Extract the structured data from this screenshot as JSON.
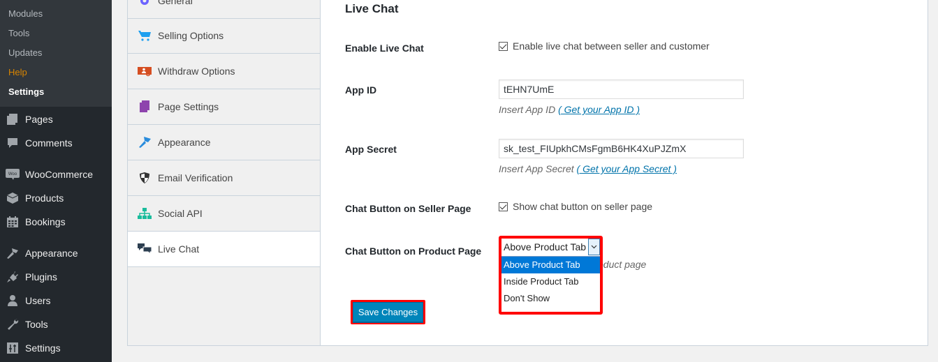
{
  "admin_menu": {
    "submenu": [
      {
        "label": "Modules",
        "state": "normal"
      },
      {
        "label": "Tools",
        "state": "normal"
      },
      {
        "label": "Updates",
        "state": "normal"
      },
      {
        "label": "Help",
        "state": "highlight"
      },
      {
        "label": "Settings",
        "state": "current"
      }
    ],
    "items": [
      {
        "label": "Pages",
        "icon": "pages-icon"
      },
      {
        "label": "Comments",
        "icon": "comments-icon"
      },
      {
        "label": "WooCommerce",
        "icon": "woocommerce-icon"
      },
      {
        "label": "Products",
        "icon": "products-icon"
      },
      {
        "label": "Bookings",
        "icon": "bookings-icon"
      },
      {
        "label": "Appearance",
        "icon": "appearance-icon"
      },
      {
        "label": "Plugins",
        "icon": "plugins-icon"
      },
      {
        "label": "Users",
        "icon": "users-icon"
      },
      {
        "label": "Tools",
        "icon": "tools-icon"
      },
      {
        "label": "Settings",
        "icon": "settings-icon"
      }
    ]
  },
  "settings_nav": {
    "items": [
      {
        "label": "General",
        "icon": "gear-icon",
        "color": "#6c63ff"
      },
      {
        "label": "Selling Options",
        "icon": "cart-icon",
        "color": "#1e9fef"
      },
      {
        "label": "Withdraw Options",
        "icon": "withdraw-icon",
        "color": "#d54e21"
      },
      {
        "label": "Page Settings",
        "icon": "page-icon",
        "color": "#8e44ad"
      },
      {
        "label": "Appearance",
        "icon": "brush-icon",
        "color": "#2a8cdc"
      },
      {
        "label": "Email Verification",
        "icon": "shield-icon",
        "color": "#333333"
      },
      {
        "label": "Social API",
        "icon": "sitemap-icon",
        "color": "#1abc9c"
      },
      {
        "label": "Live Chat",
        "icon": "chat-icon",
        "color": "#2c3e50",
        "active": true
      }
    ]
  },
  "content": {
    "title": "Live Chat",
    "fields": {
      "enable_live_chat": {
        "label": "Enable Live Chat",
        "checked": true,
        "checkbox_text": "Enable live chat between seller and customer"
      },
      "app_id": {
        "label": "App ID",
        "value": "tEHN7UmE",
        "desc": "Insert App ID",
        "link": "( Get your App ID )"
      },
      "app_secret": {
        "label": "App Secret",
        "value": "sk_test_FIUpkhCMsFgmB6HK4XuPJZmX",
        "desc": "Insert App Secret",
        "link": "( Get your App Secret )"
      },
      "chat_seller": {
        "label": "Chat Button on Seller Page",
        "checked": true,
        "checkbox_text": "Show chat button on seller page"
      },
      "chat_product": {
        "label": "Chat Button on Product Page",
        "selected": "Above Product Tab",
        "options": [
          "Above Product Tab",
          "Inside Product Tab",
          "Don't Show"
        ],
        "desc_partial": "oduct page"
      }
    },
    "save_label": "Save Changes"
  },
  "colors": {
    "highlight": "#ff0000",
    "primary_button": "#0085ba",
    "link": "#0073aa"
  }
}
